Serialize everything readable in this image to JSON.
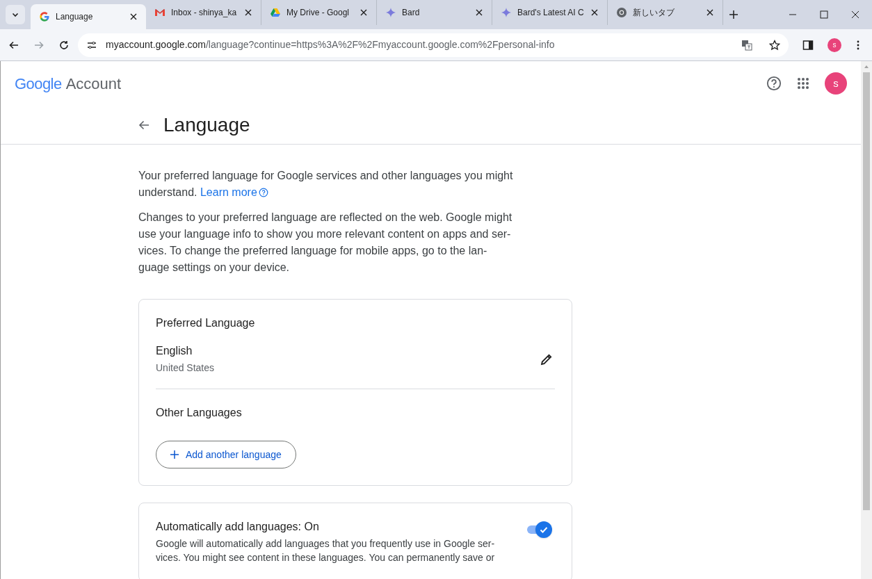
{
  "tabs": [
    {
      "title": "Language",
      "kind": "google",
      "selected": true
    },
    {
      "title": "Inbox - shinya_ka",
      "kind": "gmail",
      "selected": false
    },
    {
      "title": "My Drive - Googl",
      "kind": "drive",
      "selected": false
    },
    {
      "title": "Bard",
      "kind": "sparkle",
      "selected": false
    },
    {
      "title": "Bard's Latest AI C",
      "kind": "sparkle",
      "selected": false
    },
    {
      "title": "新しいタブ",
      "kind": "chrome",
      "selected": false
    }
  ],
  "address_bar": {
    "host": "myaccount.google.com",
    "path": "/language?continue=https%3A%2F%2Fmyaccount.google.com%2Fpersonal-info"
  },
  "browser_avatar": "s",
  "header": {
    "logo": "Google",
    "product": "Account",
    "avatar": "s"
  },
  "page_title": "Language",
  "intro": {
    "text": "Your preferred language for Google services and other languages you might understand.",
    "link": "Learn more"
  },
  "note_lines": [
    "Changes to your preferred language are reflected on the web. Google might",
    "use your language info to show you more relevant content on apps and ser-",
    "vices. To change the preferred language for mobile apps, go to the lan-",
    "guage settings on your device."
  ],
  "preferred": {
    "heading": "Preferred Language",
    "language": "English",
    "region": "United States"
  },
  "other": {
    "heading": "Other Languages",
    "add_button": "Add another language"
  },
  "auto_add": {
    "title": "Automatically add languages: On",
    "on": true,
    "description_lines": [
      "Google will automatically add languages that you frequently use in Google ser-",
      "vices. You might see content in these languages. You can permanently save or"
    ]
  }
}
